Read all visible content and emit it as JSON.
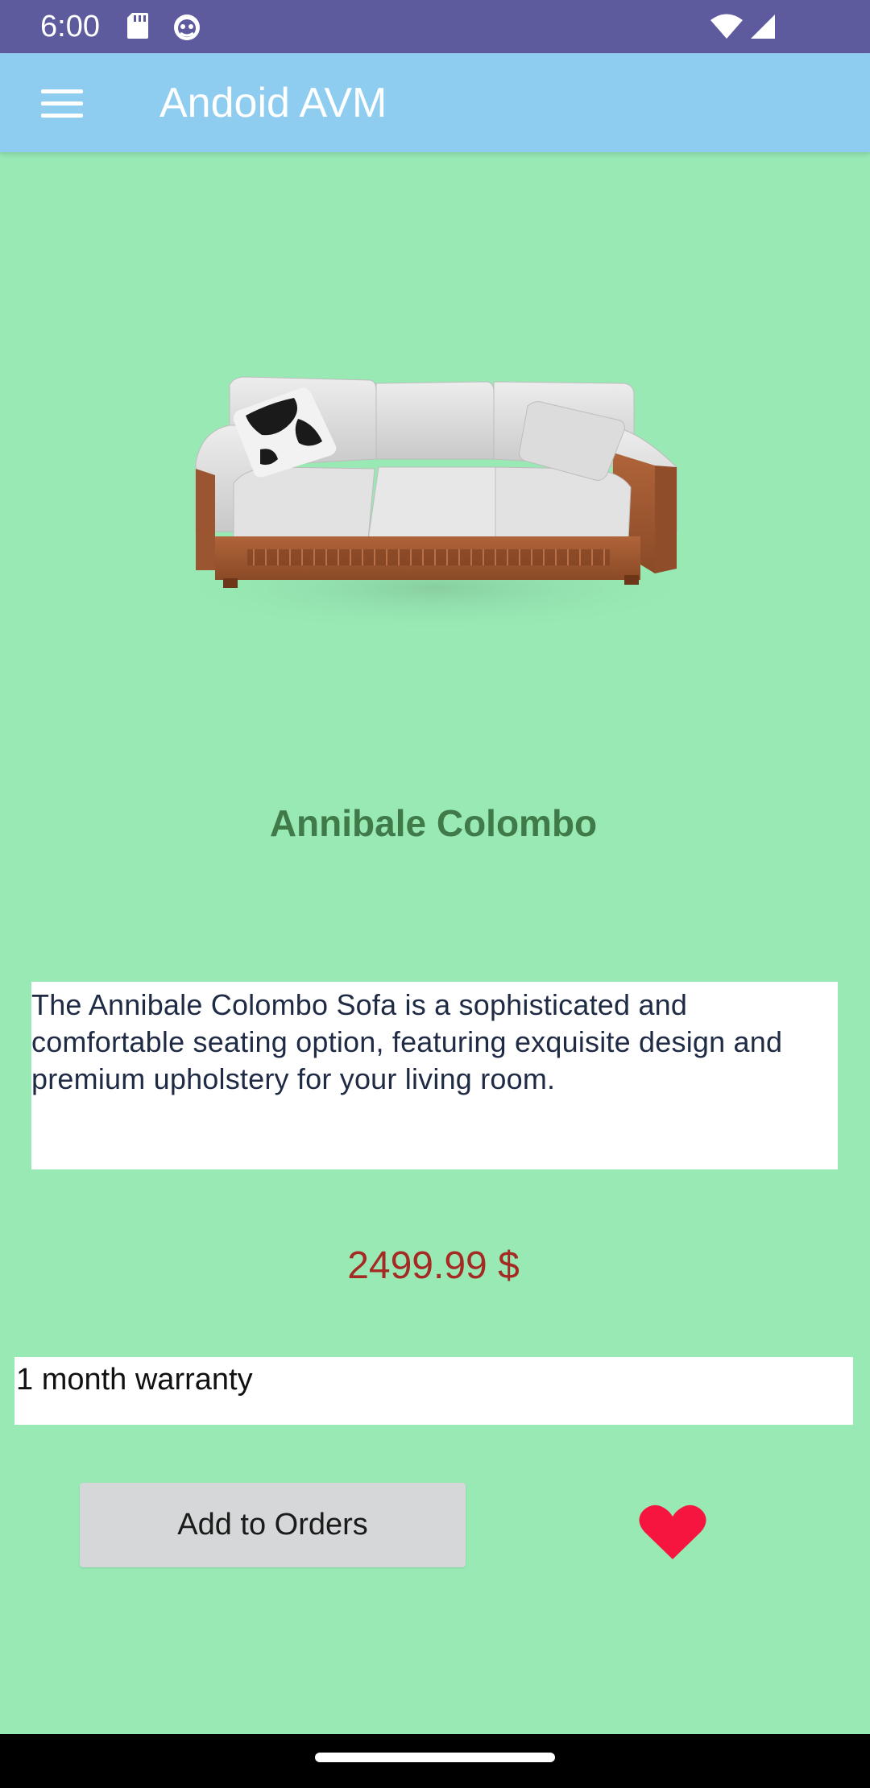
{
  "status_bar": {
    "time": "6:00",
    "icons": [
      "sd-card-icon",
      "android-debug-icon",
      "wifi-icon",
      "signal-icon"
    ]
  },
  "app_bar": {
    "title": "Andoid AVM",
    "menu_icon": "hamburger-menu-icon"
  },
  "product": {
    "image_icon": "sofa-image",
    "name": "Annibale Colombo",
    "description": "The Annibale Colombo Sofa is a sophisticated and comfortable seating option, featuring exquisite design and premium upholstery for your living room.",
    "price": "2499.99 $",
    "warranty": "1 month warranty"
  },
  "actions": {
    "add_to_orders_label": "Add to Orders",
    "favorite_icon": "heart-icon"
  },
  "colors": {
    "background": "#98E9B4",
    "status_bar": "#5E5A9E",
    "app_bar": "#8ECDF0",
    "product_name": "#3F7A48",
    "price": "#A52A24",
    "heart": "#F5153F",
    "button": "#D6D7D8"
  }
}
